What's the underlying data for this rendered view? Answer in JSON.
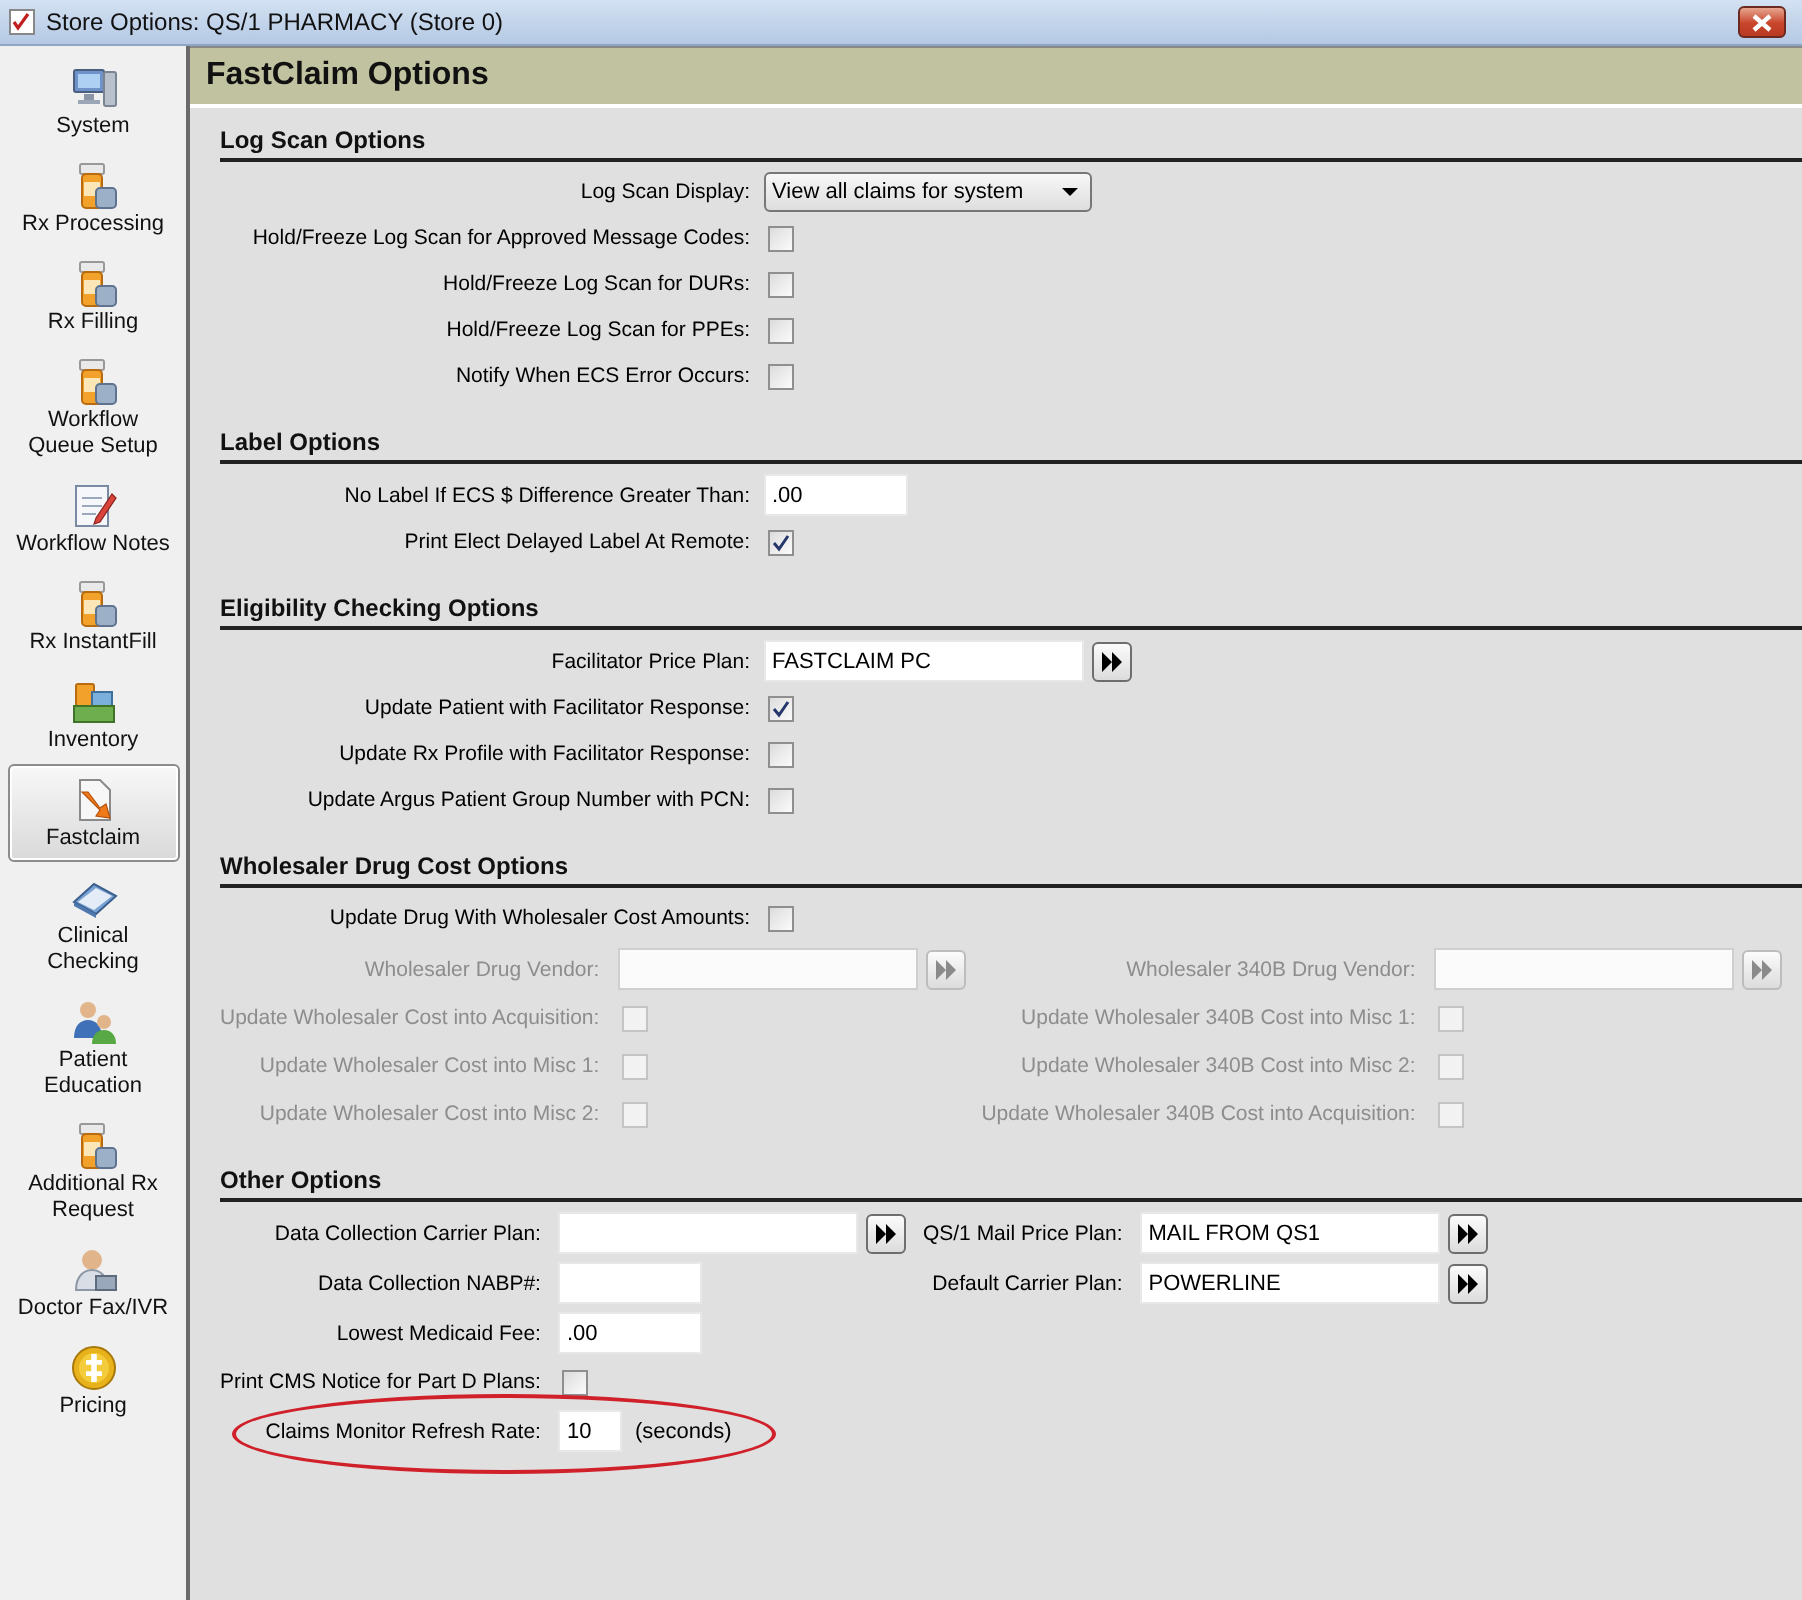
{
  "window": {
    "title": "Store Options: QS/1 PHARMACY (Store 0)"
  },
  "sidebar": {
    "items": [
      {
        "label": "System",
        "selected": false
      },
      {
        "label": "Rx Processing",
        "selected": false
      },
      {
        "label": "Rx Filling",
        "selected": false
      },
      {
        "label": "Workflow Queue Setup",
        "selected": false
      },
      {
        "label": "Workflow Notes",
        "selected": false
      },
      {
        "label": "Rx InstantFill",
        "selected": false
      },
      {
        "label": "Inventory",
        "selected": false
      },
      {
        "label": "Fastclaim",
        "selected": true
      },
      {
        "label": "Clinical Checking",
        "selected": false
      },
      {
        "label": "Patient Education",
        "selected": false
      },
      {
        "label": "Additional Rx Request",
        "selected": false
      },
      {
        "label": "Doctor Fax/IVR",
        "selected": false
      },
      {
        "label": "Pricing",
        "selected": false
      }
    ]
  },
  "page": {
    "title": "FastClaim Options"
  },
  "sections": [
    {
      "title": "Log Scan Options",
      "rows": [
        {
          "kind": "dropdown",
          "label": "Log Scan Display:",
          "value": "View all claims for system"
        },
        {
          "kind": "checkbox",
          "label": "Hold/Freeze Log Scan for Approved Message Codes:",
          "checked": false,
          "disabled": false
        },
        {
          "kind": "checkbox",
          "label": "Hold/Freeze Log Scan for DURs:",
          "checked": false,
          "disabled": false
        },
        {
          "kind": "checkbox",
          "label": "Hold/Freeze Log Scan for PPEs:",
          "checked": false,
          "disabled": false
        },
        {
          "kind": "checkbox",
          "label": "Notify When ECS Error Occurs:",
          "checked": false,
          "disabled": false
        }
      ]
    },
    {
      "title": "Label Options",
      "rows": [
        {
          "kind": "amount-field",
          "label": "No Label If ECS $ Difference Greater Than:",
          "value": ".00",
          "disabled": false
        },
        {
          "kind": "checkbox",
          "label": "Print Elect Delayed Label At Remote:",
          "checked": true,
          "disabled": false
        }
      ]
    },
    {
      "title": "Eligibility Checking Options",
      "rows": [
        {
          "kind": "text-field",
          "label": "Facilitator Price Plan:",
          "value": "FASTCLAIM PC",
          "lookup": true,
          "disabled": false
        },
        {
          "kind": "checkbox",
          "label": "Update Patient with Facilitator Response:",
          "checked": true,
          "disabled": false
        },
        {
          "kind": "checkbox",
          "label": "Update Rx Profile with Facilitator Response:",
          "checked": false,
          "disabled": false
        },
        {
          "kind": "checkbox",
          "label": "Update Argus Patient Group Number with PCN:",
          "checked": false,
          "disabled": false
        }
      ]
    },
    {
      "title": "Wholesaler Drug Cost Options",
      "rows": [
        {
          "kind": "checkbox",
          "label": "Update Drug With Wholesaler Cost Amounts:",
          "checked": false,
          "disabled": false
        }
      ],
      "split_rows": [
        {
          "left": {
            "kind": "text-field",
            "label": "Wholesaler Drug Vendor:",
            "lookup": true,
            "disabled": true
          },
          "right": {
            "kind": "text-field",
            "label": "Wholesaler 340B Drug Vendor:",
            "lookup": true,
            "disabled": true
          }
        },
        {
          "left": {
            "kind": "checkbox",
            "label": "Update Wholesaler Cost into Acquisition:",
            "checked": false,
            "disabled": true
          },
          "right": {
            "kind": "checkbox",
            "label": "Update Wholesaler 340B Cost into Misc 1:",
            "checked": false,
            "disabled": true
          }
        },
        {
          "left": {
            "kind": "checkbox",
            "label": "Update Wholesaler Cost into Misc 1:",
            "checked": false,
            "disabled": true
          },
          "right": {
            "kind": "checkbox",
            "label": "Update Wholesaler 340B Cost into Misc 2:",
            "checked": false,
            "disabled": true
          }
        },
        {
          "left": {
            "kind": "checkbox",
            "label": "Update Wholesaler Cost into Misc 2:",
            "checked": false,
            "disabled": true
          },
          "right": {
            "kind": "checkbox",
            "label": "Update Wholesaler 340B Cost into Acquisition:",
            "checked": false,
            "disabled": true
          }
        }
      ]
    },
    {
      "title": "Other Options",
      "split_rows": [
        {
          "left": {
            "kind": "text-field",
            "label": "Data Collection Carrier Plan:",
            "lookup": true,
            "disabled": false
          },
          "right": {
            "kind": "text-field",
            "label": "QS/1 Mail Price Plan:",
            "value": "MAIL FROM QS1",
            "lookup": true,
            "disabled": false
          }
        },
        {
          "left": {
            "kind": "amount-field",
            "label": "Data Collection NABP#:",
            "disabled": false
          },
          "right": {
            "kind": "text-field",
            "label": "Default Carrier Plan:",
            "value": "POWERLINE",
            "lookup": true,
            "disabled": false
          }
        },
        {
          "left": {
            "kind": "amount-field",
            "label": "Lowest Medicaid Fee:",
            "value": ".00",
            "disabled": false
          }
        },
        {
          "left": {
            "kind": "checkbox",
            "label": "Print CMS Notice for Part D Plans:",
            "checked": false,
            "disabled": false
          }
        },
        {
          "left": {
            "kind": "number-field",
            "label": "Claims Monitor Refresh Rate:",
            "value": "10",
            "suffix": "(seconds)",
            "disabled": false,
            "highlighted": true
          }
        }
      ]
    }
  ]
}
